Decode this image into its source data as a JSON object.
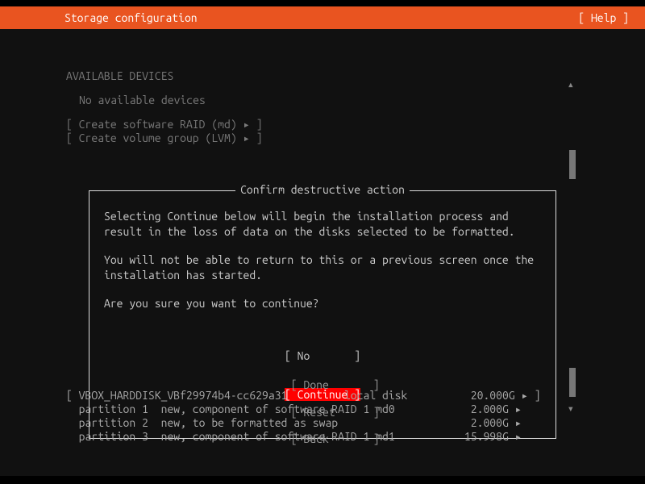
{
  "titlebar": {
    "title": "Storage configuration",
    "help": "[ Help ]"
  },
  "available": {
    "header": "AVAILABLE DEVICES",
    "none": "No available devices",
    "raid": "[ Create software RAID (md) ▸ ]",
    "lvm": "[ Create volume group (LVM) ▸ ]"
  },
  "dialog": {
    "title": "Confirm destructive action",
    "p1": "Selecting Continue below will begin the installation process and result in the loss of data on the disks selected to be formatted.",
    "p2": "You will not be able to return to this or a previous screen once the installation has started.",
    "p3": "Are you sure you want to continue?",
    "no": "[ No       ]",
    "continue": "[ Continue ]"
  },
  "device": {
    "row0": "[ VBOX_HARDDISK_VBf29974b4-cc629a31         local disk          20.000G ▸ ]",
    "row1": "  partition 1  new, component of software RAID 1 md0            2.000G ▸",
    "row2": "  partition 2  new, to be formatted as swap                     2.000G ▸",
    "row3": "  partition 3  new, component of software RAID 1 md1           15.998G ▸"
  },
  "footer": {
    "done": "[ Done       ]",
    "reset": "[ Reset      ]",
    "back": "[ Back       ]"
  },
  "glyphs": {
    "up": "▴",
    "down": "▾"
  }
}
